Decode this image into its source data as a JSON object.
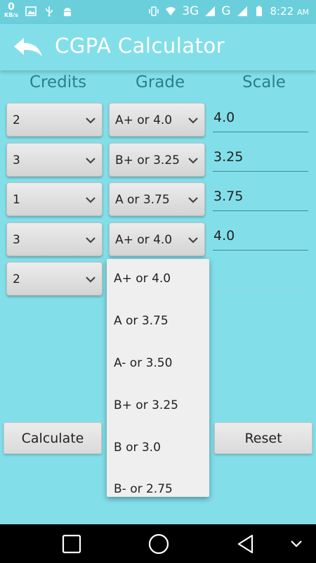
{
  "status_bar": {
    "net_speed_value": "0",
    "net_speed_unit": "KB/s",
    "network_label": "3G",
    "network_label_2": "G",
    "time": "8:22",
    "ampm": "AM"
  },
  "app_bar": {
    "title": "CGPA Calculator"
  },
  "columns": {
    "credits": "Credits",
    "grade": "Grade",
    "scale": "Scale"
  },
  "rows": [
    {
      "credit": "2",
      "grade": "A+ or 4.0",
      "scale": "4.0"
    },
    {
      "credit": "3",
      "grade": "B+ or 3.25",
      "scale": "3.25"
    },
    {
      "credit": "1",
      "grade": "A or 3.75",
      "scale": "3.75"
    },
    {
      "credit": "3",
      "grade": "A+ or 4.0",
      "scale": "4.0"
    },
    {
      "credit": "2"
    }
  ],
  "dropdown_options": [
    "A+ or 4.0",
    "A or 3.75",
    "A- or 3.50",
    "B+ or 3.25",
    "B or 3.0",
    "B- or 2.75"
  ],
  "buttons": {
    "calculate": "Calculate",
    "reset": "Reset"
  },
  "colors": {
    "background": "#82dfe9",
    "status_bar": "#6bcfdb",
    "header_text": "#2b7f8a"
  }
}
